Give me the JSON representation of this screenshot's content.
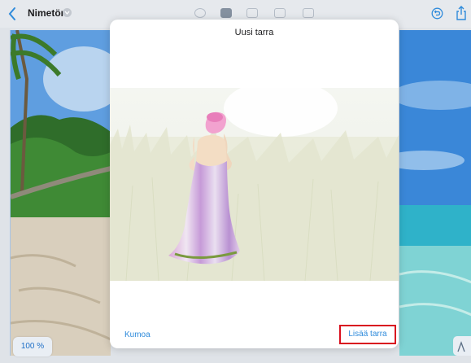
{
  "header": {
    "title": "Nimetön"
  },
  "dialog": {
    "title": "Uusi tarra",
    "cancel_label": "Kumoa",
    "add_label": "Lisää tarra"
  },
  "canvas": {
    "zoom_label": "100 %"
  },
  "colors": {
    "accent": "#2f8bdb",
    "highlight": "#d9101f"
  }
}
